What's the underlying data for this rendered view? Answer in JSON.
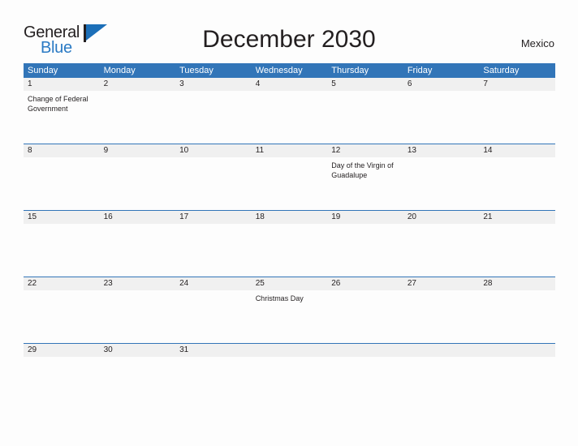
{
  "logo": {
    "line1": "General",
    "line2": "Blue",
    "flag_icon": "blue-triangle-flag-icon"
  },
  "header": {
    "title": "December 2030",
    "country": "Mexico"
  },
  "colors": {
    "header_blue": "#3275b8",
    "logo_blue": "#2a7ac4",
    "date_band_gray": "#f0f0f0",
    "text_dark": "#231f20",
    "page_background": "#fdfdfd"
  },
  "calendar": {
    "weekdays": [
      "Sunday",
      "Monday",
      "Tuesday",
      "Wednesday",
      "Thursday",
      "Friday",
      "Saturday"
    ],
    "weeks": [
      {
        "days": [
          {
            "number": "1",
            "event": "Change of Federal Government"
          },
          {
            "number": "2",
            "event": ""
          },
          {
            "number": "3",
            "event": ""
          },
          {
            "number": "4",
            "event": ""
          },
          {
            "number": "5",
            "event": ""
          },
          {
            "number": "6",
            "event": ""
          },
          {
            "number": "7",
            "event": ""
          }
        ]
      },
      {
        "days": [
          {
            "number": "8",
            "event": ""
          },
          {
            "number": "9",
            "event": ""
          },
          {
            "number": "10",
            "event": ""
          },
          {
            "number": "11",
            "event": ""
          },
          {
            "number": "12",
            "event": "Day of the Virgin of Guadalupe"
          },
          {
            "number": "13",
            "event": ""
          },
          {
            "number": "14",
            "event": ""
          }
        ]
      },
      {
        "days": [
          {
            "number": "15",
            "event": ""
          },
          {
            "number": "16",
            "event": ""
          },
          {
            "number": "17",
            "event": ""
          },
          {
            "number": "18",
            "event": ""
          },
          {
            "number": "19",
            "event": ""
          },
          {
            "number": "20",
            "event": ""
          },
          {
            "number": "21",
            "event": ""
          }
        ]
      },
      {
        "days": [
          {
            "number": "22",
            "event": ""
          },
          {
            "number": "23",
            "event": ""
          },
          {
            "number": "24",
            "event": ""
          },
          {
            "number": "25",
            "event": "Christmas Day"
          },
          {
            "number": "26",
            "event": ""
          },
          {
            "number": "27",
            "event": ""
          },
          {
            "number": "28",
            "event": ""
          }
        ]
      },
      {
        "days": [
          {
            "number": "29",
            "event": ""
          },
          {
            "number": "30",
            "event": ""
          },
          {
            "number": "31",
            "event": ""
          },
          {
            "number": "",
            "event": ""
          },
          {
            "number": "",
            "event": ""
          },
          {
            "number": "",
            "event": ""
          },
          {
            "number": "",
            "event": ""
          }
        ]
      }
    ]
  }
}
